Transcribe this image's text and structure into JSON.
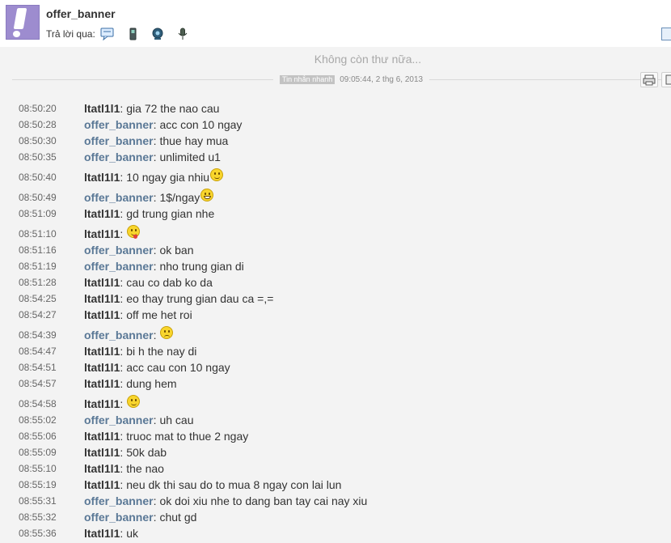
{
  "header": {
    "contact_name": "offer_banner",
    "reply_label": "Trả lời qua:",
    "reply_icons": [
      "im-icon",
      "mobile-icon",
      "video-call-icon",
      "voice-icon"
    ]
  },
  "conversation": {
    "no_more_text": "Không còn thư nữa...",
    "session_tag": "Tin nhắn nhanh",
    "session_time": "09:05:44, 2 thg 6, 2013"
  },
  "messages": [
    {
      "time": "08:50:20",
      "sender": "ltatl1l1",
      "text": "gia 72 the nao cau",
      "emoji": "",
      "me": true
    },
    {
      "time": "08:50:28",
      "sender": "offer_banner",
      "text": "acc con 10 ngay",
      "emoji": "",
      "me": false
    },
    {
      "time": "08:50:30",
      "sender": "offer_banner",
      "text": "thue hay mua",
      "emoji": "",
      "me": false
    },
    {
      "time": "08:50:35",
      "sender": "offer_banner",
      "text": "unlimited u1",
      "emoji": "",
      "me": false
    },
    {
      "time": "08:50:40",
      "sender": "ltatl1l1",
      "text": "10 ngay gia nhiu",
      "emoji": "smile",
      "me": true
    },
    {
      "time": "08:50:49",
      "sender": "offer_banner",
      "text": "1$/ngay",
      "emoji": "grin",
      "me": false
    },
    {
      "time": "08:51:09",
      "sender": "ltatl1l1",
      "text": "gd trung gian nhe",
      "emoji": "",
      "me": true
    },
    {
      "time": "08:51:10",
      "sender": "ltatl1l1",
      "text": "",
      "emoji": "tongue",
      "me": true
    },
    {
      "time": "08:51:16",
      "sender": "offer_banner",
      "text": "ok ban",
      "emoji": "",
      "me": false
    },
    {
      "time": "08:51:19",
      "sender": "offer_banner",
      "text": "nho trung gian di",
      "emoji": "",
      "me": false
    },
    {
      "time": "08:51:28",
      "sender": "ltatl1l1",
      "text": "cau co dab ko da",
      "emoji": "",
      "me": true
    },
    {
      "time": "08:54:25",
      "sender": "ltatl1l1",
      "text": "eo thay trung gian dau ca =,=",
      "emoji": "",
      "me": true
    },
    {
      "time": "08:54:27",
      "sender": "ltatl1l1",
      "text": "off me het roi",
      "emoji": "",
      "me": true
    },
    {
      "time": "08:54:39",
      "sender": "offer_banner",
      "text": "",
      "emoji": "frown",
      "me": false
    },
    {
      "time": "08:54:47",
      "sender": "ltatl1l1",
      "text": "bi h the nay di",
      "emoji": "",
      "me": true
    },
    {
      "time": "08:54:51",
      "sender": "ltatl1l1",
      "text": "acc cau con 10 ngay",
      "emoji": "",
      "me": true
    },
    {
      "time": "08:54:57",
      "sender": "ltatl1l1",
      "text": "dung hem",
      "emoji": "",
      "me": true
    },
    {
      "time": "08:54:58",
      "sender": "ltatl1l1",
      "text": "",
      "emoji": "smile",
      "me": true
    },
    {
      "time": "08:55:02",
      "sender": "offer_banner",
      "text": "uh cau",
      "emoji": "",
      "me": false
    },
    {
      "time": "08:55:06",
      "sender": "ltatl1l1",
      "text": "truoc mat to thue 2 ngay",
      "emoji": "",
      "me": true
    },
    {
      "time": "08:55:09",
      "sender": "ltatl1l1",
      "text": "50k dab",
      "emoji": "",
      "me": true
    },
    {
      "time": "08:55:10",
      "sender": "ltatl1l1",
      "text": "the nao",
      "emoji": "",
      "me": true
    },
    {
      "time": "08:55:19",
      "sender": "ltatl1l1",
      "text": "neu dk thi sau do to mua 8 ngay con lai lun",
      "emoji": "",
      "me": true
    },
    {
      "time": "08:55:31",
      "sender": "offer_banner",
      "text": "ok doi xiu nhe to dang ban tay cai nay xiu",
      "emoji": "",
      "me": false
    },
    {
      "time": "08:55:32",
      "sender": "offer_banner",
      "text": "chut gd",
      "emoji": "",
      "me": false
    },
    {
      "time": "08:55:36",
      "sender": "ltatl1l1",
      "text": "uk",
      "emoji": "",
      "me": true
    }
  ]
}
